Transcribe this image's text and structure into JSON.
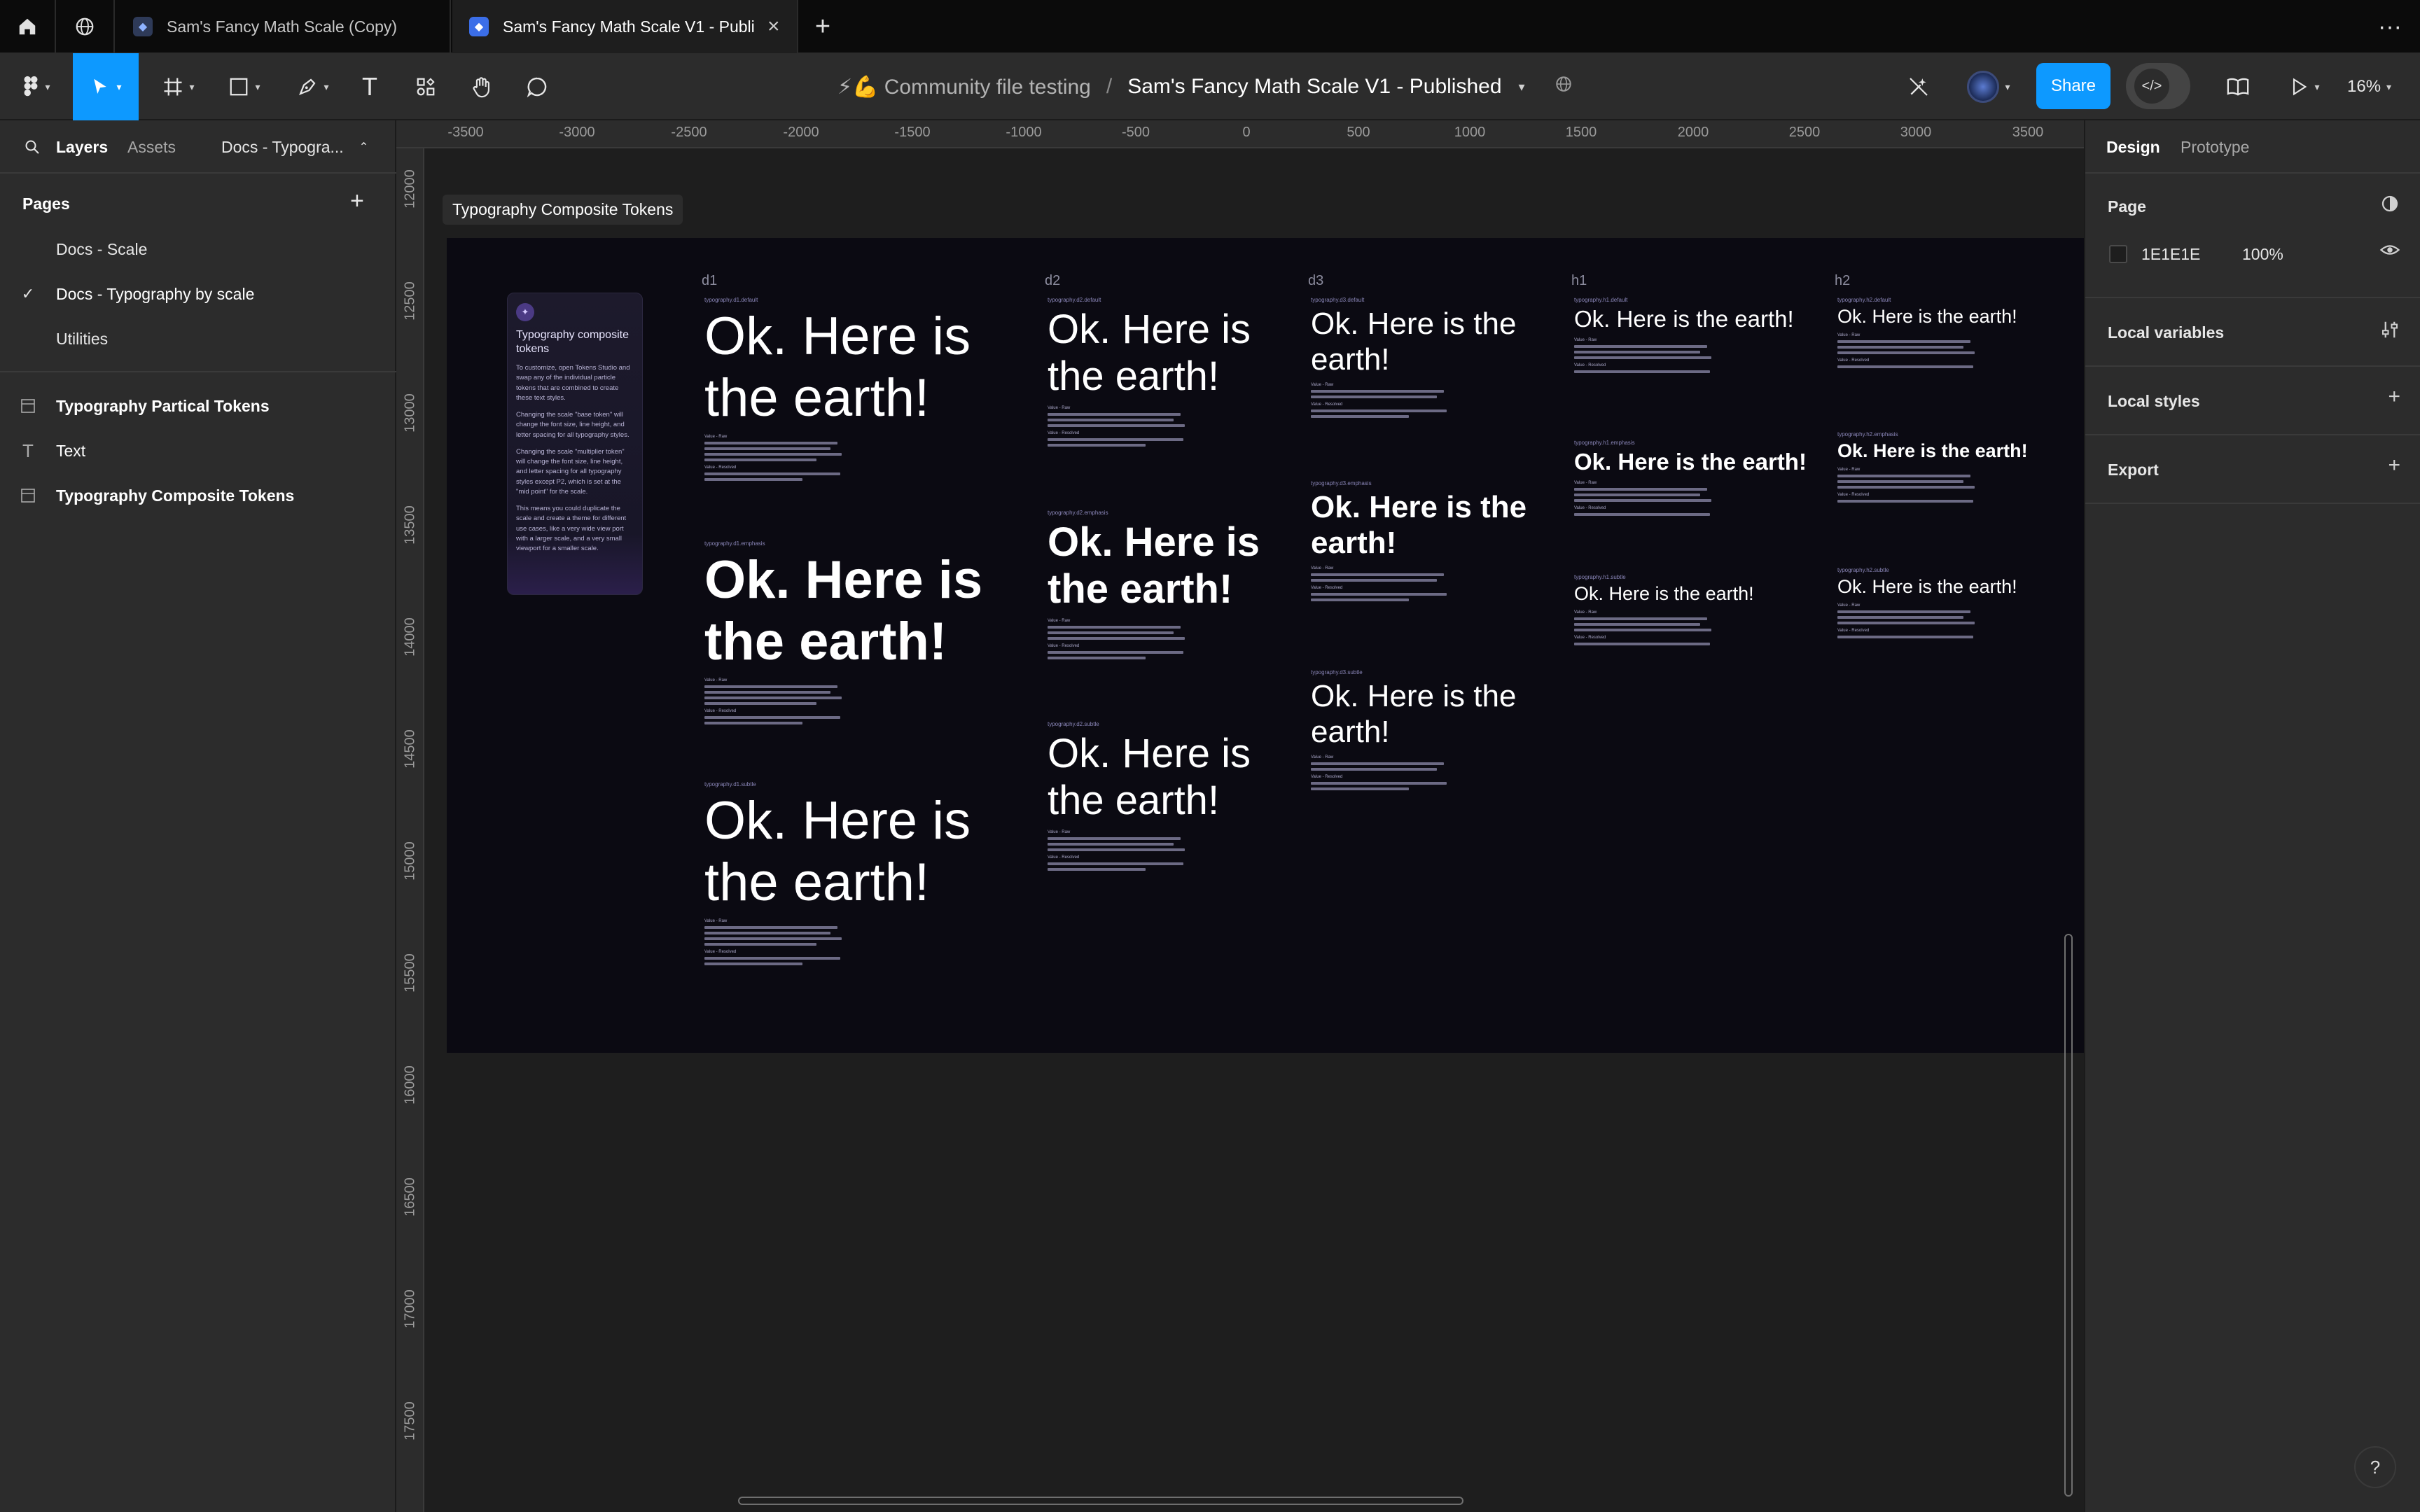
{
  "tabs": {
    "items": [
      {
        "label": "Sam's Fancy Math Scale (Copy)"
      },
      {
        "label": "Sam's Fancy Math Scale V1 - Publi"
      }
    ]
  },
  "toolbar": {
    "team": "⚡💪 Community file testing",
    "separator": "/",
    "file_name": "Sam's Fancy Math Scale V1 - Published",
    "share_label": "Share",
    "zoom": "16%",
    "colors": {
      "accent": "#0d99ff"
    }
  },
  "left_panel": {
    "tabs": [
      "Layers",
      "Assets"
    ],
    "current_page_short": "Docs - Typogra...",
    "pages_label": "Pages",
    "pages": [
      {
        "label": "Docs - Scale"
      },
      {
        "label": "Docs - Typography by scale"
      },
      {
        "label": "Utilities"
      }
    ],
    "layers": [
      {
        "label": "Typography Partical Tokens",
        "icon": "frame-icon"
      },
      {
        "label": "Text",
        "icon": "text-icon"
      },
      {
        "label": "Typography Composite Tokens",
        "icon": "frame-icon"
      }
    ]
  },
  "rulers": {
    "x": [
      "-3500",
      "-3000",
      "-2500",
      "-2000",
      "-1500",
      "-1000",
      "-500",
      "0",
      "500",
      "1000",
      "1500",
      "2000",
      "2500",
      "3000",
      "3500"
    ],
    "y": [
      "12000",
      "12500",
      "13000",
      "13500",
      "14000",
      "14500",
      "15000",
      "15500",
      "16000",
      "16500",
      "17000",
      "17500"
    ]
  },
  "canvas": {
    "frame_label": "Typography Composite Tokens",
    "card": {
      "title": "Typography composite tokens",
      "paragraphs": [
        "To customize, open Tokens Studio and swap any of the individual particle tokens that are combined to create these text styles.",
        "Changing the scale \"base token\" will change the font size, line height, and letter spacing for all typography styles.",
        "Changing the scale \"multiplier token\" will change the font size, line height, and letter spacing for all typography styles except P2, which is set at the \"mid point\" for the scale.",
        "This means you could duplicate the scale and create a theme for different use cases, like a very wide view port with a larger scale, and a very small viewport for a smaller scale."
      ]
    },
    "columns": [
      "d1",
      "d2",
      "d3",
      "h1",
      "h2"
    ],
    "sample": "Ok. Here is the earth!",
    "token_labels": {
      "d1": [
        "typography.d1.default",
        "typography.d1.emphasis",
        "typography.d1.subtle"
      ],
      "d2": [
        "typography.d2.default",
        "typography.d2.emphasis",
        "typography.d2.subtle"
      ],
      "d3": [
        "typography.d3.default",
        "typography.d3.emphasis",
        "typography.d3.subtle"
      ],
      "h1": [
        "typography.h1.default",
        "typography.h1.emphasis",
        "typography.h1.subtle"
      ],
      "h2": [
        "typography.h2.default",
        "typography.h2.emphasis",
        "typography.h2.subtle"
      ]
    },
    "meta_labels": [
      "Value - Raw",
      "Value - Resolved"
    ]
  },
  "right_panel": {
    "tabs": [
      "Design",
      "Prototype"
    ],
    "page_section": "Page",
    "bg_hex": "1E1E1E",
    "bg_opacity": "100%",
    "local_variables": "Local variables",
    "local_styles": "Local styles",
    "export": "Export"
  },
  "help_label": "?"
}
